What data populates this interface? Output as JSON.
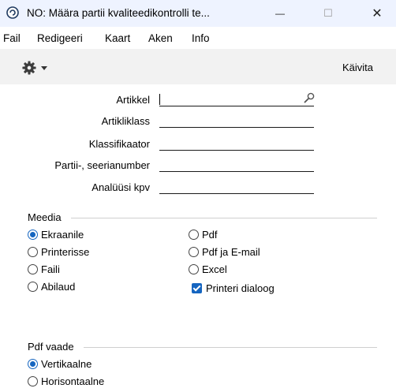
{
  "window": {
    "title": "NO: Määra partii kvaliteedikontrolli te...",
    "minimize_glyph": "—",
    "maximize_glyph": "☐",
    "close_glyph": "✕"
  },
  "menu": [
    "Fail",
    "Redigeeri",
    "Kaart",
    "Aken",
    "Info"
  ],
  "toolbar": {
    "run_label": "Käivita",
    "settings_icon": "gear-icon"
  },
  "form": {
    "fields": [
      {
        "label": "Artikkel",
        "value": ""
      },
      {
        "label": "Artikliklass",
        "value": ""
      },
      {
        "label": "Klassifikaator",
        "value": ""
      },
      {
        "label": "Partii-, seerianumber",
        "value": ""
      },
      {
        "label": "Analüüsi kpv",
        "value": ""
      }
    ]
  },
  "media": {
    "title": "Meedia",
    "options": [
      {
        "label": "Ekraanile",
        "selected": true
      },
      {
        "label": "Printerisse",
        "selected": false
      },
      {
        "label": "Faili",
        "selected": false
      },
      {
        "label": "Abilaud",
        "selected": false
      },
      {
        "label": "Pdf",
        "selected": false
      },
      {
        "label": "Pdf ja E-mail",
        "selected": false
      },
      {
        "label": "Excel",
        "selected": false
      }
    ],
    "printer_dialog": {
      "label": "Printeri dialoog",
      "checked": true
    }
  },
  "pdf_view": {
    "title": "Pdf vaade",
    "options": [
      {
        "label": "Vertikaalne",
        "selected": true
      },
      {
        "label": "Horisontaalne",
        "selected": false
      }
    ]
  },
  "colors": {
    "accent": "#1565c0",
    "titlebar": "#eef3ff",
    "toolbar": "#f2f2f2"
  }
}
